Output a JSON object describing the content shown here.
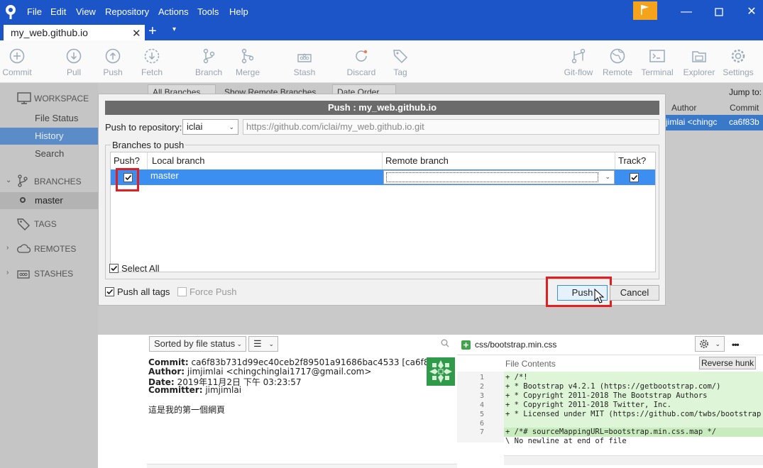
{
  "titlebar": {
    "menu": [
      "File",
      "Edit",
      "View",
      "Repository",
      "Actions",
      "Tools",
      "Help"
    ],
    "accent_color": "#1b55c8",
    "flag_color": "#f4a31a"
  },
  "tabs": {
    "repo_tab": "my_web.github.io",
    "close_glyph": "✕",
    "new_tab_glyph": "+",
    "dropdown_glyph": "▾"
  },
  "toolbar": {
    "items": [
      {
        "label": "Commit",
        "icon": "commit-icon"
      },
      {
        "label": "Pull",
        "icon": "pull-icon"
      },
      {
        "label": "Push",
        "icon": "push-icon"
      },
      {
        "label": "Fetch",
        "icon": "fetch-icon"
      },
      {
        "label": "Branch",
        "icon": "branch-icon"
      },
      {
        "label": "Merge",
        "icon": "merge-icon"
      },
      {
        "label": "Stash",
        "icon": "stash-icon"
      },
      {
        "label": "Discard",
        "icon": "discard-icon"
      },
      {
        "label": "Tag",
        "icon": "tag-icon"
      },
      {
        "label": "Git-flow",
        "icon": "gitflow-icon"
      },
      {
        "label": "Remote",
        "icon": "globe-icon"
      },
      {
        "label": "Terminal",
        "icon": "terminal-icon"
      },
      {
        "label": "Explorer",
        "icon": "folder-icon"
      },
      {
        "label": "Settings",
        "icon": "gear-icon"
      }
    ]
  },
  "sidebar": {
    "workspace": "WORKSPACE",
    "file_status": "File Status",
    "history": "History",
    "search": "Search",
    "branches": "BRANCHES",
    "master": "master",
    "tags": "TAGS",
    "remotes": "REMOTES",
    "stashes": "STASHES"
  },
  "history": {
    "all_branches": "All Branches",
    "show_remote": "Show Remote Branches",
    "date_order": "Date Order",
    "jump_to": "Jump to:",
    "author_col": "Author",
    "commit_col": "Commit",
    "row_author": "jimlai <chingc",
    "row_commit": "ca6f83b"
  },
  "dialog": {
    "title": "Push : my_web.github.io",
    "push_to_label": "Push to repository:",
    "remote_value": "iclai",
    "remote_url": "https://github.com/iclai/my_web.github.io.git",
    "branches_legend": "Branches to push",
    "col_push": "Push?",
    "col_local": "Local branch",
    "col_remote": "Remote branch",
    "col_track": "Track?",
    "row_local": "master",
    "row_remote": "",
    "select_all": "Select All",
    "push_all_tags": "Push all tags",
    "force_push": "Force Push",
    "push_button": "Push",
    "cancel_button": "Cancel",
    "highlight_color": "#e02020",
    "row_color": "#3c8ff0"
  },
  "details": {
    "sort_combo": "Sorted by file status",
    "list_glyph": "☰",
    "commit_label": "Commit:",
    "commit_value": "ca6f83b731d99ec40ceb2f89501a91686bac4533 [ca6f83b]",
    "author_label": "Author:",
    "author_value": "jimjimlai <chingchinglai1717@gmail.com>",
    "date_label": "Date:",
    "date_value": "2019年11月2日 下午 03:23:57",
    "committer_label": "Committer:",
    "committer_value": "jimjimlai",
    "message": "這是我的第一個網頁",
    "bottom_partial": "jimjimlai"
  },
  "diff": {
    "file_name": "css/bootstrap.min.css",
    "file_contents": "File Contents",
    "reverse_hunk": "Reverse hunk",
    "more_glyph": "•••",
    "lines": [
      {
        "n": "1",
        "text": "+ /*!",
        "added": true
      },
      {
        "n": "2",
        "text": "+  * Bootstrap v4.2.1 (https://getbootstrap.com/)",
        "added": true
      },
      {
        "n": "3",
        "text": "+  * Copyright 2011-2018 The Bootstrap Authors",
        "added": true
      },
      {
        "n": "4",
        "text": "+  * Copyright 2011-2018 Twitter, Inc.",
        "added": true
      },
      {
        "n": "5",
        "text": "+  * Licensed under MIT (https://github.com/twbs/bootstrap",
        "added": true
      },
      {
        "n": "6",
        "text": "",
        "added": true
      },
      {
        "n": "7",
        "text": "+ /*# sourceMappingURL=bootstrap.min.css.map */",
        "added": true
      },
      {
        "n": "",
        "text": "\\  No newline at end of file",
        "added": false
      }
    ],
    "added_color": "#dff5d8"
  }
}
